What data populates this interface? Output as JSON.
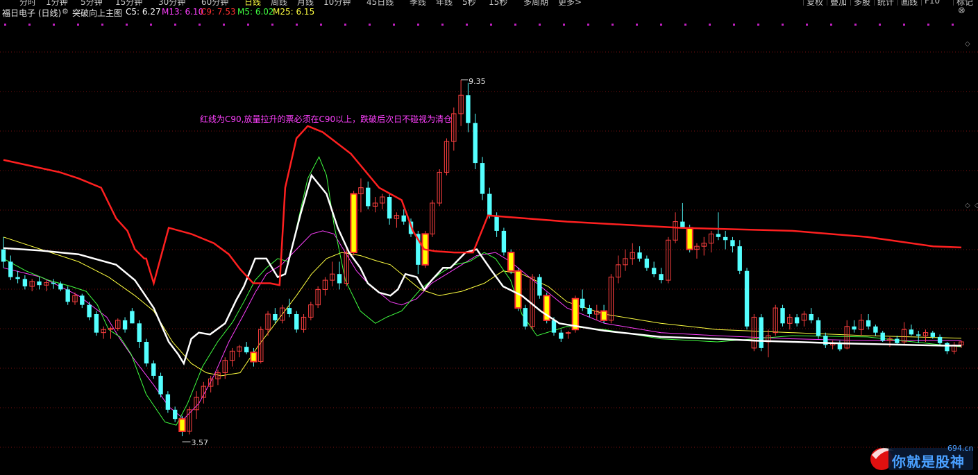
{
  "toolbar": {
    "periods": [
      "分时",
      "1分钟",
      "5分钟",
      "15分钟",
      "30分钟",
      "60分钟",
      "日线",
      "周线",
      "月线",
      "10分钟",
      "45日线",
      "季线",
      "年线",
      "5秒",
      "15秒",
      "多周期",
      "更多>"
    ],
    "active_period": "日线",
    "right_buttons": [
      "复权",
      "叠加",
      "多股",
      "统计",
      "画线",
      "F10",
      "标记"
    ]
  },
  "info": {
    "stock": "福日电子 (日线)",
    "indicator": "突破向上主图",
    "c5": "C5: 6.27",
    "m13": "M13: 6.10",
    "c9": "C9: 7.53",
    "m5": "M5: 6.02",
    "m25": "M25: 6.15"
  },
  "colors": {
    "up": "#ff4040",
    "down": "#54ffff",
    "signal_fill": "#ffff00",
    "signal_border": "#ff3030",
    "c90_line": "#ff2020",
    "c5_line": "#ffffff",
    "m13_line": "#ff40ff",
    "m5_line": "#40ff40",
    "m25_line": "#ffff40",
    "grid": "#7a1010",
    "text_info": "#e0e0e0"
  },
  "annotation": "红线为C90,放量拉升的票必须在C90以上，跌破后次日不碰视为清仓",
  "logo": {
    "text": "你就是股神",
    "domain": "694.cn"
  },
  "chart_data": {
    "type": "candlestick",
    "y_range": [
      3.2,
      9.8
    ],
    "price_high_label": "9.35",
    "price_low_label": "3.57",
    "candles": [
      [
        6.6,
        6.8,
        6.3,
        6.4
      ],
      [
        6.4,
        6.5,
        6.1,
        6.15
      ],
      [
        6.15,
        6.25,
        6.05,
        6.12
      ],
      [
        6.12,
        6.18,
        5.95,
        6.0
      ],
      [
        6.0,
        6.12,
        5.92,
        6.08
      ],
      [
        6.08,
        6.15,
        5.95,
        6.02
      ],
      [
        6.02,
        6.1,
        5.92,
        6.06
      ],
      [
        6.06,
        6.12,
        5.96,
        6.04
      ],
      [
        6.04,
        6.08,
        5.92,
        5.95
      ],
      [
        5.95,
        6.0,
        5.7,
        5.75
      ],
      [
        5.75,
        5.9,
        5.7,
        5.85
      ],
      [
        5.85,
        5.88,
        5.65,
        5.7
      ],
      [
        5.7,
        5.75,
        5.45,
        5.5
      ],
      [
        5.55,
        5.6,
        5.2,
        5.25
      ],
      [
        5.25,
        5.35,
        5.15,
        5.3
      ],
      [
        5.3,
        5.35,
        5.15,
        5.32
      ],
      [
        5.32,
        5.48,
        5.28,
        5.45
      ],
      [
        5.45,
        5.5,
        5.25,
        5.3
      ],
      [
        5.6,
        5.65,
        5.4,
        5.4
      ],
      [
        5.4,
        5.45,
        5.0,
        5.1
      ],
      [
        5.1,
        5.15,
        4.7,
        4.75
      ],
      [
        4.75,
        4.8,
        4.5,
        4.55
      ],
      [
        4.55,
        4.6,
        4.2,
        4.25
      ],
      [
        4.25,
        4.3,
        3.95,
        4.0
      ],
      [
        4.0,
        4.05,
        3.8,
        3.85
      ],
      [
        3.85,
        3.9,
        3.57,
        3.65
      ],
      [
        3.65,
        4.05,
        3.6,
        4.0
      ],
      [
        4.0,
        4.3,
        3.85,
        4.2
      ],
      [
        4.2,
        4.45,
        4.1,
        4.38
      ],
      [
        4.38,
        4.55,
        4.28,
        4.5
      ],
      [
        4.5,
        4.65,
        4.4,
        4.6
      ],
      [
        4.6,
        4.85,
        4.5,
        4.8
      ],
      [
        4.8,
        5.0,
        4.7,
        4.95
      ],
      [
        4.95,
        5.05,
        4.85,
        5.02
      ],
      [
        5.02,
        5.1,
        4.9,
        4.93
      ],
      [
        4.93,
        5.0,
        4.7,
        4.78
      ],
      [
        4.78,
        5.35,
        4.75,
        5.3
      ],
      [
        5.3,
        5.6,
        5.2,
        5.55
      ],
      [
        5.55,
        5.65,
        5.4,
        5.45
      ],
      [
        5.45,
        5.7,
        5.4,
        5.65
      ],
      [
        5.65,
        5.8,
        5.5,
        5.55
      ],
      [
        5.55,
        5.6,
        5.25,
        5.3
      ],
      [
        5.3,
        5.55,
        5.25,
        5.5
      ],
      [
        5.5,
        5.75,
        5.45,
        5.7
      ],
      [
        5.7,
        6.0,
        5.65,
        5.95
      ],
      [
        5.95,
        6.15,
        5.85,
        6.1
      ],
      [
        6.1,
        6.4,
        6.0,
        6.2
      ],
      [
        6.2,
        6.4,
        5.95,
        6.05
      ],
      [
        6.05,
        6.6,
        6.0,
        6.55
      ],
      [
        6.55,
        7.55,
        6.5,
        7.5
      ],
      [
        7.5,
        7.75,
        7.2,
        7.6
      ],
      [
        7.6,
        7.7,
        7.25,
        7.3
      ],
      [
        7.3,
        7.45,
        7.2,
        7.35
      ],
      [
        7.35,
        7.5,
        7.25,
        7.45
      ],
      [
        7.45,
        7.5,
        7.0,
        7.1
      ],
      [
        7.1,
        7.2,
        6.95,
        7.15
      ],
      [
        7.15,
        7.25,
        7.0,
        7.05
      ],
      [
        7.05,
        7.1,
        6.8,
        6.85
      ],
      [
        6.85,
        6.9,
        6.2,
        6.35
      ],
      [
        6.35,
        6.9,
        6.3,
        6.85
      ],
      [
        6.85,
        7.4,
        6.8,
        7.35
      ],
      [
        7.35,
        7.9,
        7.3,
        7.85
      ],
      [
        7.85,
        8.4,
        7.8,
        8.35
      ],
      [
        8.35,
        8.9,
        8.2,
        8.8
      ],
      [
        8.8,
        9.35,
        8.6,
        9.1
      ],
      [
        9.1,
        9.3,
        8.5,
        8.65
      ],
      [
        8.65,
        8.8,
        7.9,
        8.0
      ],
      [
        8.0,
        8.1,
        7.4,
        7.5
      ],
      [
        7.5,
        7.6,
        7.1,
        7.15
      ],
      [
        7.15,
        7.2,
        6.8,
        6.9
      ],
      [
        6.9,
        6.95,
        6.5,
        6.55
      ],
      [
        6.55,
        6.6,
        6.2,
        6.25
      ],
      [
        6.25,
        6.3,
        5.6,
        5.65
      ],
      [
        5.65,
        5.7,
        5.3,
        5.35
      ],
      [
        5.35,
        6.2,
        5.3,
        6.15
      ],
      [
        6.15,
        6.2,
        5.8,
        5.85
      ],
      [
        5.85,
        5.9,
        5.4,
        5.45
      ],
      [
        5.45,
        5.5,
        5.2,
        5.25
      ],
      [
        5.25,
        5.3,
        5.1,
        5.15
      ],
      [
        5.25,
        5.28,
        5.15,
        5.25
      ],
      [
        5.3,
        5.85,
        5.25,
        5.8
      ],
      [
        5.8,
        5.95,
        5.6,
        5.65
      ],
      [
        5.65,
        5.7,
        5.5,
        5.55
      ],
      [
        5.55,
        5.7,
        5.45,
        5.6
      ],
      [
        5.6,
        5.7,
        5.4,
        5.45
      ],
      [
        5.45,
        6.2,
        5.4,
        6.15
      ],
      [
        6.15,
        6.5,
        6.05,
        6.35
      ],
      [
        6.35,
        6.6,
        6.25,
        6.45
      ],
      [
        6.45,
        6.7,
        6.35,
        6.55
      ],
      [
        6.55,
        6.65,
        6.4,
        6.45
      ],
      [
        6.45,
        6.5,
        6.25,
        6.3
      ],
      [
        6.3,
        6.4,
        6.15,
        6.2
      ],
      [
        6.2,
        6.3,
        6.05,
        6.1
      ],
      [
        6.1,
        6.8,
        6.05,
        6.75
      ],
      [
        6.75,
        7.2,
        6.7,
        7.05
      ],
      [
        7.05,
        7.35,
        6.95,
        6.95
      ],
      [
        6.95,
        7.0,
        6.55,
        6.6
      ],
      [
        6.6,
        6.7,
        6.45,
        6.65
      ],
      [
        6.65,
        6.8,
        6.5,
        6.7
      ],
      [
        6.7,
        6.9,
        6.55,
        6.85
      ],
      [
        6.85,
        7.2,
        6.75,
        6.8
      ],
      [
        6.8,
        6.9,
        6.6,
        6.75
      ],
      [
        6.75,
        6.8,
        6.55,
        6.65
      ],
      [
        6.65,
        6.75,
        6.2,
        6.25
      ],
      [
        6.25,
        6.3,
        5.3,
        5.35
      ],
      [
        5.0,
        5.55,
        4.95,
        5.5
      ],
      [
        5.5,
        5.55,
        4.95,
        5.0
      ],
      [
        5.1,
        5.3,
        4.85,
        5.2
      ],
      [
        5.25,
        5.7,
        5.2,
        5.65
      ],
      [
        5.65,
        5.7,
        5.35,
        5.4
      ],
      [
        5.4,
        5.55,
        5.3,
        5.5
      ],
      [
        5.5,
        5.55,
        5.35,
        5.4
      ],
      [
        5.45,
        5.6,
        5.35,
        5.55
      ],
      [
        5.55,
        5.65,
        5.4,
        5.45
      ],
      [
        5.45,
        5.5,
        5.15,
        5.2
      ],
      [
        5.2,
        5.25,
        5.0,
        5.05
      ],
      [
        5.05,
        5.12,
        4.98,
        5.08
      ],
      [
        5.08,
        5.12,
        4.95,
        4.98
      ],
      [
        5.0,
        5.45,
        4.98,
        5.35
      ],
      [
        5.35,
        5.45,
        5.25,
        5.3
      ],
      [
        5.3,
        5.55,
        5.2,
        5.45
      ],
      [
        5.45,
        5.55,
        5.3,
        5.35
      ],
      [
        5.35,
        5.38,
        5.2,
        5.25
      ],
      [
        5.25,
        5.28,
        5.1,
        5.12
      ],
      [
        5.12,
        5.18,
        5.02,
        5.15
      ],
      [
        5.15,
        5.2,
        5.05,
        5.08
      ],
      [
        5.1,
        5.42,
        5.05,
        5.3
      ],
      [
        5.3,
        5.38,
        5.2,
        5.22
      ],
      [
        5.22,
        5.28,
        5.08,
        5.2
      ],
      [
        5.2,
        5.3,
        5.1,
        5.25
      ],
      [
        5.25,
        5.28,
        5.15,
        5.18
      ],
      [
        5.18,
        5.22,
        5.05,
        5.08
      ],
      [
        5.08,
        5.1,
        4.9,
        4.95
      ],
      [
        4.95,
        5.1,
        4.9,
        5.05
      ],
      [
        5.05,
        5.12,
        5.0,
        5.1
      ]
    ],
    "signals": [
      25,
      35,
      49,
      59,
      71,
      72,
      76,
      80,
      84,
      96
    ],
    "c90": [
      [
        0,
        8.05
      ],
      [
        15,
        7.95
      ],
      [
        30,
        7.85
      ],
      [
        40,
        7.75
      ],
      [
        52,
        7.6
      ],
      [
        60,
        7.1
      ],
      [
        66,
        6.9
      ],
      [
        70,
        6.6
      ],
      [
        75,
        6.45
      ],
      [
        76,
        6.45
      ],
      [
        80,
        6.05
      ],
      [
        88,
        6.95
      ],
      [
        100,
        6.85
      ],
      [
        112,
        6.7
      ],
      [
        120,
        6.52
      ],
      [
        126,
        6.28
      ],
      [
        133,
        6.05
      ],
      [
        142,
        6.05
      ],
      [
        147,
        6.02
      ],
      [
        150,
        7.6
      ],
      [
        156,
        8.4
      ],
      [
        162,
        8.6
      ],
      [
        170,
        8.5
      ],
      [
        185,
        8.15
      ],
      [
        200,
        7.6
      ],
      [
        212,
        7.4
      ],
      [
        218,
        6.9
      ],
      [
        224,
        6.6
      ],
      [
        230,
        6.57
      ],
      [
        240,
        6.55
      ],
      [
        250,
        6.55
      ],
      [
        258,
        7.15
      ],
      [
        300,
        7.05
      ],
      [
        360,
        6.95
      ],
      [
        420,
        6.9
      ],
      [
        460,
        6.8
      ],
      [
        495,
        6.65
      ],
      [
        510,
        6.63
      ]
    ],
    "c5": [
      [
        0,
        6.62
      ],
      [
        20,
        6.58
      ],
      [
        40,
        6.52
      ],
      [
        60,
        6.35
      ],
      [
        70,
        6.1
      ],
      [
        80,
        5.65
      ],
      [
        88,
        5.1
      ],
      [
        93,
        4.9
      ],
      [
        96,
        4.75
      ],
      [
        100,
        5.15
      ],
      [
        104,
        5.25
      ],
      [
        110,
        5.22
      ],
      [
        118,
        5.4
      ],
      [
        124,
        5.78
      ],
      [
        128,
        6.0
      ],
      [
        134,
        6.45
      ],
      [
        140,
        6.45
      ],
      [
        146,
        6.15
      ],
      [
        150,
        6.2
      ],
      [
        158,
        7.15
      ],
      [
        164,
        7.8
      ],
      [
        172,
        7.5
      ],
      [
        178,
        6.95
      ],
      [
        184,
        6.55
      ],
      [
        190,
        6.3
      ],
      [
        194,
        6.05
      ],
      [
        200,
        5.9
      ],
      [
        206,
        5.85
      ],
      [
        210,
        5.95
      ],
      [
        214,
        6.2
      ],
      [
        220,
        6.15
      ],
      [
        224,
        5.95
      ],
      [
        228,
        6.1
      ],
      [
        234,
        6.3
      ],
      [
        238,
        6.3
      ],
      [
        246,
        6.55
      ],
      [
        252,
        6.6
      ],
      [
        260,
        6.25
      ],
      [
        266,
        6.0
      ],
      [
        276,
        5.85
      ],
      [
        286,
        5.6
      ],
      [
        296,
        5.4
      ],
      [
        320,
        5.28
      ],
      [
        350,
        5.18
      ],
      [
        380,
        5.15
      ],
      [
        400,
        5.12
      ],
      [
        420,
        5.1
      ],
      [
        440,
        5.08
      ],
      [
        500,
        5.04
      ],
      [
        510,
        5.04
      ]
    ],
    "m13": [
      [
        0,
        6.3
      ],
      [
        20,
        6.15
      ],
      [
        40,
        5.85
      ],
      [
        55,
        5.5
      ],
      [
        62,
        5.15
      ],
      [
        70,
        4.8
      ],
      [
        80,
        4.4
      ],
      [
        88,
        4.05
      ],
      [
        96,
        3.85
      ],
      [
        104,
        4.1
      ],
      [
        112,
        4.55
      ],
      [
        120,
        5.1
      ],
      [
        128,
        5.55
      ],
      [
        134,
        5.9
      ],
      [
        140,
        6.2
      ],
      [
        148,
        6.35
      ],
      [
        156,
        6.6
      ],
      [
        164,
        6.85
      ],
      [
        170,
        6.9
      ],
      [
        176,
        6.85
      ],
      [
        182,
        6.55
      ],
      [
        188,
        6.25
      ],
      [
        194,
        6.05
      ],
      [
        200,
        5.9
      ],
      [
        206,
        5.75
      ],
      [
        212,
        5.7
      ],
      [
        220,
        5.8
      ],
      [
        228,
        6.05
      ],
      [
        236,
        6.2
      ],
      [
        244,
        6.35
      ],
      [
        252,
        6.5
      ],
      [
        262,
        6.55
      ],
      [
        270,
        6.4
      ],
      [
        280,
        6.15
      ],
      [
        290,
        5.9
      ],
      [
        300,
        5.65
      ],
      [
        320,
        5.4
      ],
      [
        350,
        5.25
      ],
      [
        380,
        5.2
      ],
      [
        420,
        5.15
      ],
      [
        460,
        5.12
      ],
      [
        510,
        5.12
      ]
    ],
    "m5": [
      [
        0,
        6.45
      ],
      [
        12,
        6.25
      ],
      [
        24,
        6.1
      ],
      [
        36,
        6.0
      ],
      [
        44,
        5.92
      ],
      [
        50,
        5.7
      ],
      [
        56,
        5.3
      ],
      [
        62,
        5.18
      ],
      [
        68,
        4.9
      ],
      [
        76,
        4.25
      ],
      [
        86,
        3.8
      ],
      [
        92,
        3.75
      ],
      [
        98,
        4.1
      ],
      [
        106,
        4.7
      ],
      [
        114,
        5.1
      ],
      [
        122,
        5.42
      ],
      [
        128,
        5.75
      ],
      [
        134,
        6.1
      ],
      [
        140,
        6.3
      ],
      [
        146,
        6.45
      ],
      [
        152,
        6.4
      ],
      [
        156,
        6.95
      ],
      [
        162,
        7.75
      ],
      [
        168,
        8.1
      ],
      [
        172,
        7.8
      ],
      [
        176,
        7.0
      ],
      [
        182,
        6.1
      ],
      [
        190,
        5.6
      ],
      [
        198,
        5.4
      ],
      [
        204,
        5.5
      ],
      [
        212,
        5.6
      ],
      [
        222,
        5.95
      ],
      [
        232,
        6.2
      ],
      [
        240,
        6.35
      ],
      [
        248,
        6.4
      ],
      [
        256,
        6.55
      ],
      [
        262,
        6.45
      ],
      [
        270,
        6.1
      ],
      [
        276,
        5.55
      ],
      [
        284,
        5.2
      ],
      [
        300,
        5.35
      ],
      [
        320,
        5.3
      ],
      [
        350,
        5.15
      ],
      [
        380,
        5.1
      ],
      [
        420,
        5.2
      ],
      [
        460,
        5.18
      ],
      [
        500,
        5.05
      ],
      [
        510,
        5.02
      ]
    ],
    "m25": [
      [
        0,
        6.8
      ],
      [
        20,
        6.6
      ],
      [
        40,
        6.4
      ],
      [
        56,
        6.15
      ],
      [
        70,
        5.85
      ],
      [
        80,
        5.6
      ],
      [
        90,
        5.1
      ],
      [
        100,
        4.75
      ],
      [
        108,
        4.6
      ],
      [
        116,
        4.55
      ],
      [
        126,
        4.6
      ],
      [
        136,
        5.05
      ],
      [
        146,
        5.45
      ],
      [
        156,
        5.85
      ],
      [
        164,
        6.2
      ],
      [
        172,
        6.45
      ],
      [
        180,
        6.55
      ],
      [
        190,
        6.5
      ],
      [
        198,
        6.42
      ],
      [
        206,
        6.35
      ],
      [
        214,
        6.15
      ],
      [
        222,
        5.95
      ],
      [
        232,
        5.85
      ],
      [
        244,
        5.92
      ],
      [
        256,
        6.05
      ],
      [
        266,
        6.25
      ],
      [
        276,
        6.2
      ],
      [
        290,
        6.0
      ],
      [
        300,
        5.75
      ],
      [
        320,
        5.55
      ],
      [
        350,
        5.4
      ],
      [
        380,
        5.3
      ],
      [
        420,
        5.25
      ],
      [
        460,
        5.2
      ],
      [
        510,
        5.16
      ]
    ]
  }
}
